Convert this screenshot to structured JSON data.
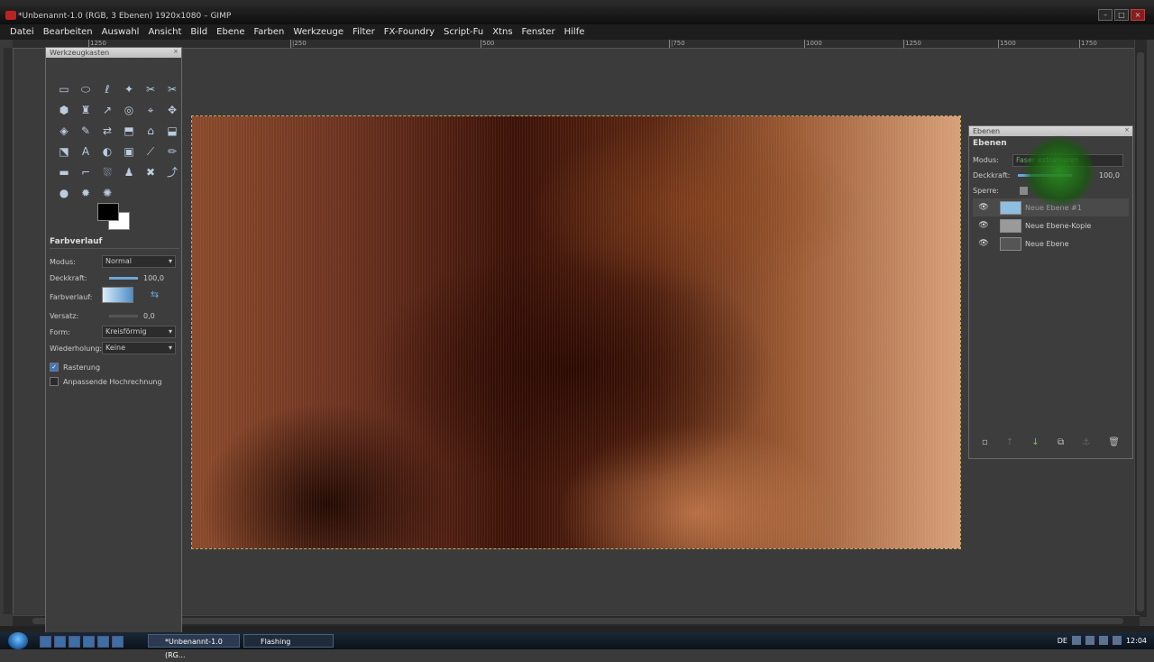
{
  "window": {
    "title": "*Unbenannt-1.0 (RGB, 3 Ebenen) 1920x1080 – GIMP"
  },
  "menu": [
    "Datei",
    "Bearbeiten",
    "Auswahl",
    "Ansicht",
    "Bild",
    "Ebene",
    "Farben",
    "Werkzeuge",
    "Filter",
    "FX-Foundry",
    "Script-Fu",
    "Xtns",
    "Fenster",
    "Hilfe"
  ],
  "ruler": {
    "ticks": [
      "1250",
      "|250",
      "500",
      "|750",
      "1000",
      "1250",
      "1500",
      "1750"
    ]
  },
  "toolbox": {
    "title": "Werkzeugkasten",
    "tools": [
      "▭",
      "⬭",
      "ℓ",
      "✦",
      "✂",
      "✂",
      "⬢",
      "♜",
      "↗",
      "◎",
      "⌖",
      "✥",
      "◈",
      "✎",
      "⇄",
      "⬒",
      "⌂",
      "⬓",
      "⬔",
      "A",
      "◐",
      "▣",
      "⟋",
      "✏",
      "▬",
      "⌐",
      "⛆",
      "♟",
      "✖",
      "⤴",
      "●",
      "✹",
      "✺"
    ],
    "options": {
      "section": "Farbverlauf",
      "modus_label": "Modus:",
      "modus_value": "Normal",
      "deckkraft_label": "Deckkraft:",
      "deckkraft_value": "100,0",
      "farbverlauf_label": "Farbverlauf:",
      "versatz_label": "Versatz:",
      "versatz_value": "0,0",
      "form_label": "Form:",
      "form_value": "Kreisförmig",
      "wiederholung_label": "Wiederholung:",
      "wiederholung_value": "Keine",
      "rasterung_label": "Rasterung",
      "anpassende_label": "Anpassende Hochrechnung"
    }
  },
  "layers": {
    "title": "Ebenen",
    "heading": "Ebenen",
    "modus_label": "Modus:",
    "modus_value": "Faser extrahieren",
    "deckkraft_label": "Deckkraft:",
    "deckkraft_value": "100,0",
    "sperre_label": "Sperre:",
    "items": [
      {
        "name": "Neue Ebene #1",
        "selected": true,
        "thumb": "#8fbfe0"
      },
      {
        "name": "Neue Ebene-Kopie",
        "selected": false,
        "thumb": "#9a9a9a"
      },
      {
        "name": "Neue Ebene",
        "selected": false,
        "thumb": "#555555"
      }
    ]
  },
  "taskbar": {
    "tasks": [
      "*Unbenannt-1.0 (RG...",
      "Flashing"
    ],
    "lang": "DE",
    "clock": "12:04"
  }
}
